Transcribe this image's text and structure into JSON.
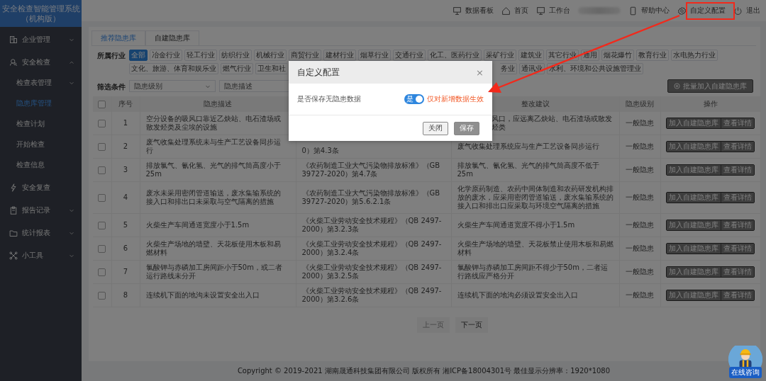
{
  "sidebar": {
    "title_lines": [
      "安全检查智能管理系统",
      "（机构版）"
    ],
    "items": [
      {
        "label": "企业管理",
        "selected": false,
        "expanded": false
      },
      {
        "label": "安全检查",
        "selected": false,
        "expanded": true,
        "children": [
          {
            "label": "检查表管理",
            "selected": false,
            "expanded": false
          },
          {
            "label": "隐患库管理",
            "selected": true
          },
          {
            "label": "检查计划",
            "selected": false
          },
          {
            "label": "开始检查",
            "selected": false
          },
          {
            "label": "检查信息",
            "selected": false
          }
        ]
      },
      {
        "label": "安全复查",
        "selected": false
      },
      {
        "label": "报告记录",
        "selected": false,
        "expanded": false
      },
      {
        "label": "统计报表",
        "selected": false,
        "expanded": false
      },
      {
        "label": "小工具",
        "selected": false,
        "expanded": false
      }
    ]
  },
  "topnav": [
    {
      "kind": "link",
      "label": "数据看板",
      "highlighted": false
    },
    {
      "kind": "link",
      "label": "首页",
      "highlighted": false
    },
    {
      "kind": "link",
      "label": "工作台",
      "highlighted": false
    },
    {
      "kind": "blurred"
    },
    {
      "kind": "link",
      "label": "帮助中心",
      "highlighted": false
    },
    {
      "kind": "link",
      "label": "自定义配置",
      "highlighted": true
    },
    {
      "kind": "link",
      "label": "退出",
      "highlighted": false
    }
  ],
  "tabs": [
    {
      "label": "推荐隐患库",
      "selected": true
    },
    {
      "label": "自建隐患库",
      "selected": false
    }
  ],
  "industry": {
    "label": "所属行业",
    "tag_rows": [
      [
        {
          "label": "全部",
          "selected": true,
          "kind": "whole"
        },
        {
          "label": "冶金行业",
          "selected": false,
          "kind": "whole"
        },
        {
          "label": "轻工行业",
          "selected": false,
          "kind": "whole"
        },
        {
          "label": "纺织行业",
          "selected": false,
          "kind": "whole"
        },
        {
          "label": "机械行业",
          "selected": false,
          "kind": "whole"
        },
        {
          "label": "商贸行业",
          "selected": false,
          "kind": "whole"
        },
        {
          "label": "建材行业",
          "selected": false,
          "kind": "whole"
        },
        {
          "label": "烟草行业",
          "selected": false,
          "kind": "whole"
        },
        {
          "label": "交通行业",
          "selected": false,
          "kind": "whole"
        },
        {
          "label": "化工、医药行业",
          "selected": false,
          "kind": "whole"
        },
        {
          "label": "采矿行业",
          "selected": false,
          "kind": "whole"
        },
        {
          "label": "建筑业",
          "selected": false,
          "kind": "whole"
        },
        {
          "label": "其它行业",
          "selected": false,
          "kind": "whole"
        },
        {
          "label": "通用",
          "selected": false,
          "kind": "whole"
        },
        {
          "label": "烟花爆竹",
          "selected": false,
          "kind": "whole"
        },
        {
          "label": "教育行业",
          "selected": false,
          "kind": "whole"
        },
        {
          "label": "水电热力行业",
          "selected": false,
          "kind": "whole"
        }
      ],
      [
        {
          "label": "文化、旅游、体育和娱乐业",
          "selected": false,
          "kind": "whole"
        },
        {
          "label": "燃气行业",
          "selected": false,
          "kind": "whole"
        },
        {
          "label": "卫生和社",
          "selected": false,
          "kind": "cut_end"
        },
        {
          "label": "务业",
          "selected": false,
          "kind": "cut_start"
        },
        {
          "label": "通讯业",
          "selected": false,
          "kind": "whole"
        },
        {
          "label": "水利、环境和公共设施管理业",
          "selected": false,
          "kind": "whole"
        }
      ]
    ]
  },
  "filter": {
    "label": "筛选条件",
    "level_select": {
      "placeholder": "隐患级别"
    },
    "description_field": {
      "placeholder": "隐患描述"
    },
    "batch_button": "批量加入自建隐患库"
  },
  "table": {
    "header_checked": false,
    "columns": {
      "no": "序号",
      "description": "隐患描述",
      "suggestion": "整改建议",
      "level": "隐患级别",
      "actions": "操作"
    },
    "rows": [
      {
        "checked": false,
        "no": "1",
        "description": "空分设备的吸风口靠近乙炔站、电石渣场或散发烃类及尘埃的设施",
        "suggestion": "风口，应远离乙炔站、电石渣场或散发烃类",
        "suggestion_cut": true,
        "level": "一般隐患",
        "actions": [
          "加入自建隐患库",
          "查看详情"
        ]
      },
      {
        "checked": false,
        "no": "2",
        "description": "废气收集处理系统未与生产工艺设备同步运行",
        "standard": "0）第4.3条",
        "standard_cut": true,
        "suggestion": "废气收集处理系统应与生产工艺设备同步运行",
        "level": "一般隐患",
        "actions": [
          "加入自建隐患库",
          "查看详情"
        ]
      },
      {
        "checked": false,
        "no": "3",
        "description": "排放氯气、氰化氢、光气的排气筒高度小于25m",
        "standard": "《农药制造工业大气污染物排放标准》（GB 39727-2020）第4.7条",
        "suggestion": "排放氯气、氰化氢、光气的排气筒高度不低于25m",
        "level": "一般隐患",
        "actions": [
          "加入自建隐患库",
          "查看详情"
        ]
      },
      {
        "checked": false,
        "no": "4",
        "description": "废水未采用密闭管道输送，废水集输系统的接入口和排出口未采取与空气隔离的措施",
        "standard": "《农药制造工业大气污染物排放标准》（GB 39727-2020）第5.6.2.1条",
        "suggestion": "化学原药制造、农药中间体制造和农药研发机构排放的废水，应采用密闭管道输送，废水集输系统的接入口和排出口应采取与环境空气隔离的措施",
        "level": "一般隐患",
        "actions": [
          "加入自建隐患库",
          "查看详情"
        ]
      },
      {
        "checked": false,
        "no": "5",
        "description": "火柴生产车间通道宽度小于1.5m",
        "standard": "《火柴工业劳动安全技术规程》（QB 2497-2000）第3.2.3条",
        "suggestion": "火柴生产车间通道宽度不得小于1.5m",
        "level": "一般隐患",
        "actions": [
          "加入自建隐患库",
          "查看详情"
        ]
      },
      {
        "checked": false,
        "no": "6",
        "description": "火柴生产场地的墙壁、天花板使用木板和易燃材料",
        "standard": "《火柴工业劳动安全技术规程》（QB 2497-2000）第3.2.4条",
        "suggestion": "火柴生产场地的墙壁、天花板禁止使用木板和易燃材料",
        "level": "一般隐患",
        "actions": [
          "加入自建隐患库",
          "查看详情"
        ]
      },
      {
        "checked": false,
        "no": "7",
        "description": "氯酸钾与赤磷加工房间距小于50m，或二者运行路线未分开",
        "standard": "《火柴工业劳动安全技术规程》（QB 2497-2000）第3.2.5条",
        "suggestion": "氯酸钾与赤磷加工房间距不得少于50m，二者运行路线应严格分开",
        "level": "一般隐患",
        "actions": [
          "加入自建隐患库",
          "查看详情"
        ]
      },
      {
        "checked": false,
        "no": "8",
        "description": "连续机下面的地沟未设置安全出入口",
        "standard": "《火柴工业劳动安全技术规程》（QB 2497-2000）第3.2.6条",
        "suggestion": "连续机下面的地沟必须设置安全出入口",
        "level": "一般隐患",
        "actions": [
          "加入自建隐患库",
          "查看详情"
        ]
      }
    ]
  },
  "pagination": {
    "prev": {
      "label": "上一页",
      "disabled": true
    },
    "next": {
      "label": "下一页",
      "disabled": false
    }
  },
  "footer": "Copyright © 2019-2021 湖南晟通科技集团有限公司 版权所有 湘ICP备18004301号 最佳显示分辨率：1920*1080",
  "modal": {
    "title": "自定义配置",
    "close": "×",
    "setting": {
      "label": "是否保存无隐患数据",
      "switch": {
        "text": "是",
        "on": true
      },
      "hint": "仅对新增数据生效"
    },
    "buttons": [
      {
        "label": "关闭",
        "kind": "default"
      },
      {
        "label": "保存",
        "kind": "primary"
      }
    ]
  },
  "annotation": {
    "arrow": true
  },
  "chat_widget": {
    "label": "在线咨询"
  }
}
